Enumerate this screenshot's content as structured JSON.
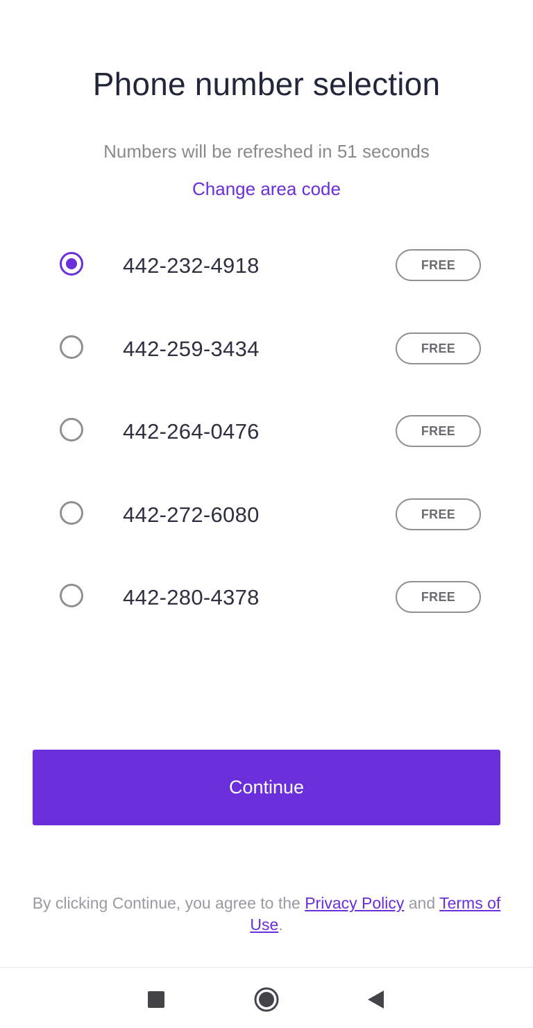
{
  "header": {
    "title": "Phone number selection",
    "refresh_text": "Numbers will be refreshed in 51 seconds",
    "change_area_code": "Change area code"
  },
  "numbers": [
    {
      "number": "442-232-4918",
      "badge": "FREE",
      "selected": true
    },
    {
      "number": "442-259-3434",
      "badge": "FREE",
      "selected": false
    },
    {
      "number": "442-264-0476",
      "badge": "FREE",
      "selected": false
    },
    {
      "number": "442-272-6080",
      "badge": "FREE",
      "selected": false
    },
    {
      "number": "442-280-4378",
      "badge": "FREE",
      "selected": false
    }
  ],
  "continue_label": "Continue",
  "legal": {
    "prefix": "By clicking Continue, you agree to the ",
    "privacy": "Privacy Policy",
    "and": " and ",
    "terms": "Terms of Use",
    "suffix": "."
  },
  "colors": {
    "accent": "#6a2edb",
    "text": "#23263a",
    "muted": "#8a8a8e"
  },
  "navbar": {
    "icons": [
      "recent-apps-icon",
      "home-icon",
      "back-icon"
    ]
  }
}
